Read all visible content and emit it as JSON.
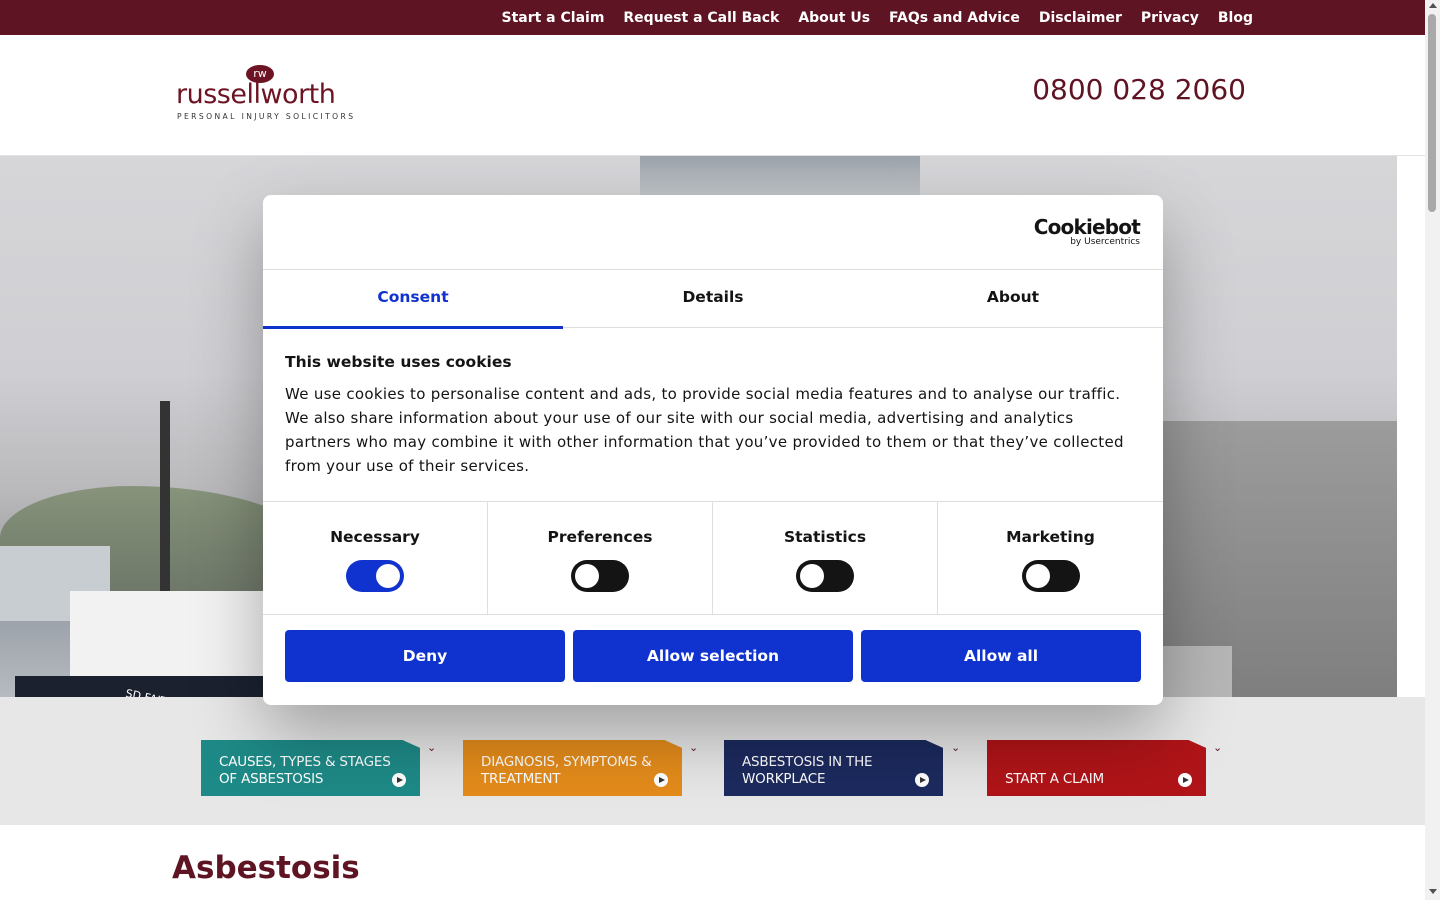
{
  "topnav": [
    "Start a Claim",
    "Request a Call Back",
    "About Us",
    "FAQs and Advice",
    "Disclaimer",
    "Privacy",
    "Blog"
  ],
  "header": {
    "logo_mark": "rw",
    "logo_word": "russellworth",
    "logo_tagline": "PERSONAL INJURY SOLICITORS",
    "phone": "0800 028 2060"
  },
  "hero": {
    "ship_name": "SD FAITHFUL"
  },
  "categories": [
    {
      "label": "CAUSES, TYPES & STAGES OF ASBESTOSIS",
      "color": "#1e8a87"
    },
    {
      "label": "DIAGNOSIS, SYMPTOMS & TREATMENT",
      "color": "#e48c1b"
    },
    {
      "label": "ASBESTOSIS IN THE WORKPLACE",
      "color": "#1c2a5e"
    },
    {
      "label": "START A CLAIM",
      "color": "#b01418"
    }
  ],
  "page": {
    "title": "Asbestosis"
  },
  "cookie": {
    "brand": "Cookiebot",
    "brand_by": "by Usercentrics",
    "tabs": [
      "Consent",
      "Details",
      "About"
    ],
    "active_tab": "Consent",
    "title": "This website uses cookies",
    "body": "We use cookies to personalise content and ads, to provide social media features and to analyse our traffic. We also share information about your use of our site with our social media, advertising and analytics partners who may combine it with other information that you’ve provided to them or that they’ve collected from your use of their services.",
    "toggles": [
      {
        "label": "Necessary",
        "on": true
      },
      {
        "label": "Preferences",
        "on": false
      },
      {
        "label": "Statistics",
        "on": false
      },
      {
        "label": "Marketing",
        "on": false
      }
    ],
    "buttons": {
      "deny": "Deny",
      "allow_selection": "Allow selection",
      "allow_all": "Allow all"
    },
    "accent": "#1032cf"
  },
  "colors": {
    "brand": "#5f1423"
  }
}
